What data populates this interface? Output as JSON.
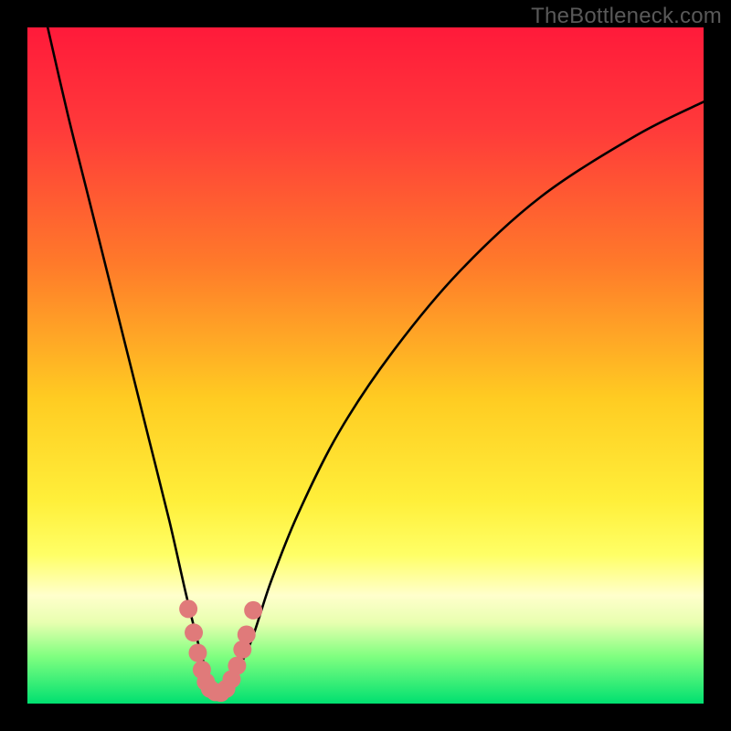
{
  "watermark": "TheBottleneck.com",
  "chart_data": {
    "type": "line",
    "title": "",
    "xlabel": "",
    "ylabel": "",
    "xlim": [
      0,
      100
    ],
    "ylim": [
      0,
      100
    ],
    "gradient_stops": [
      {
        "offset": 0.0,
        "color": "#ff1a3a"
      },
      {
        "offset": 0.15,
        "color": "#ff3a3a"
      },
      {
        "offset": 0.35,
        "color": "#ff7a2a"
      },
      {
        "offset": 0.55,
        "color": "#ffcc22"
      },
      {
        "offset": 0.7,
        "color": "#ffef3a"
      },
      {
        "offset": 0.78,
        "color": "#ffff66"
      },
      {
        "offset": 0.84,
        "color": "#ffffcc"
      },
      {
        "offset": 0.88,
        "color": "#e8ffb0"
      },
      {
        "offset": 0.93,
        "color": "#80ff80"
      },
      {
        "offset": 1.0,
        "color": "#00e070"
      }
    ],
    "series": [
      {
        "name": "bottleneck-curve",
        "x": [
          3,
          6,
          9,
          12,
          15,
          18,
          21,
          23.5,
          25.5,
          27,
          28.5,
          30,
          33,
          36,
          40,
          46,
          54,
          64,
          76,
          90,
          100
        ],
        "y": [
          100,
          87,
          75,
          63,
          51,
          39,
          27,
          16,
          8,
          3.5,
          1.5,
          3,
          9,
          18,
          28,
          40,
          52,
          64,
          75,
          84,
          89
        ]
      }
    ],
    "markers": {
      "name": "highlight-region",
      "color": "#e07a7a",
      "points": [
        {
          "x": 23.8,
          "y": 14
        },
        {
          "x": 24.6,
          "y": 10.5
        },
        {
          "x": 25.2,
          "y": 7.5
        },
        {
          "x": 25.8,
          "y": 5
        },
        {
          "x": 26.4,
          "y": 3.2
        },
        {
          "x": 27.0,
          "y": 2.2
        },
        {
          "x": 27.8,
          "y": 1.7
        },
        {
          "x": 28.6,
          "y": 1.6
        },
        {
          "x": 29.4,
          "y": 2.2
        },
        {
          "x": 30.2,
          "y": 3.6
        },
        {
          "x": 31.0,
          "y": 5.6
        },
        {
          "x": 31.8,
          "y": 8.0
        },
        {
          "x": 32.4,
          "y": 10.2
        },
        {
          "x": 33.4,
          "y": 13.8
        }
      ]
    }
  }
}
